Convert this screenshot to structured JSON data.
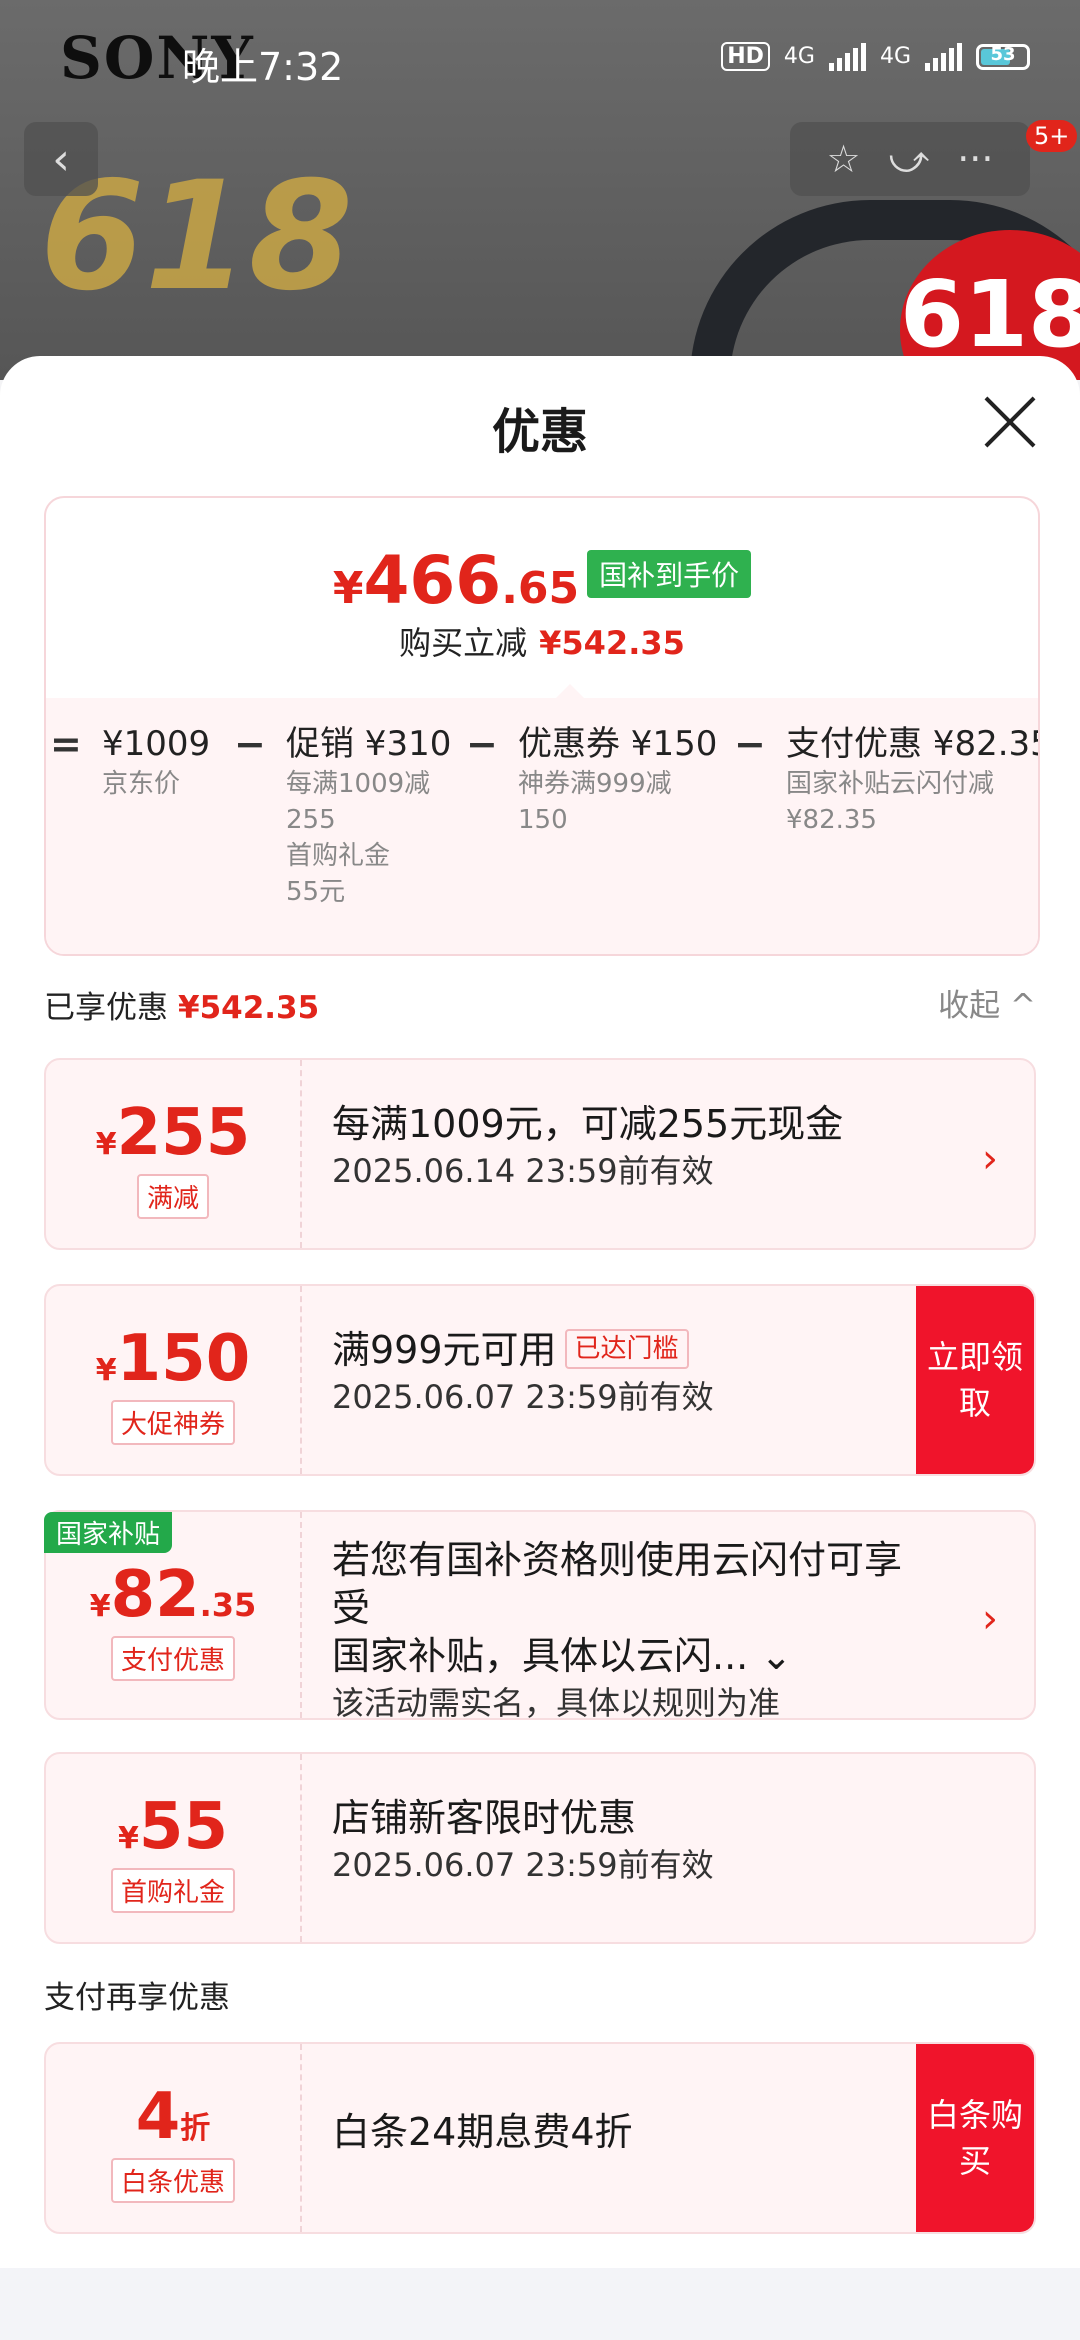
{
  "status_bar": {
    "time": "晚上7:32",
    "hd_label": "HD",
    "network_1": "4G",
    "network_2": "4G",
    "battery": "53"
  },
  "background": {
    "brand_logo": "SONY",
    "promo_badge": "618",
    "promo_deco": "618"
  },
  "top_actions": {
    "back_icon": "‹",
    "star_icon": "☆",
    "share_icon": "⤻",
    "more_icon": "···",
    "message_badge": "5+"
  },
  "sheet": {
    "title": "优惠",
    "summary": {
      "price_yen": "¥",
      "price_int": "466",
      "price_dec": ".65",
      "price_tag": "国补到手价",
      "reduce_label": "购买立减",
      "reduce_amount": "¥542.35",
      "calc": [
        {
          "op": "=",
          "head": "¥1009",
          "lines": [
            "京东价"
          ]
        },
        {
          "op": "−",
          "head": "促销 ¥310",
          "lines": [
            "每满1009减",
            "255",
            "首购礼金",
            "55元"
          ]
        },
        {
          "op": "−",
          "head": "优惠券 ¥150",
          "lines": [
            "神券满999减",
            "150"
          ]
        },
        {
          "op": "−",
          "head": "支付优惠 ¥82.35",
          "lines": [
            "国家补贴云闪付减",
            "¥82.35"
          ]
        }
      ]
    },
    "enjoyed_label": "已享优惠",
    "enjoyed_amount": "¥542.35",
    "collapse_label": "收起 ^",
    "coupons": [
      {
        "yen": "¥",
        "amount": "255",
        "dec": "",
        "label": "满减",
        "title": "每满1009元，可减255元现金",
        "subtitle": "2025.06.14 23:59前有效",
        "arrow": "›"
      },
      {
        "yen": "¥",
        "amount": "150",
        "dec": "",
        "label": "大促神券",
        "title": "满999元可用",
        "state": "已达门槛",
        "subtitle": "2025.06.07 23:59前有效",
        "cta": "立即领取"
      },
      {
        "gov_tag": "国家补贴",
        "yen": "¥",
        "amount": "82",
        "dec": ".35",
        "label": "支付优惠",
        "title": "若您有国补资格则使用云闪付可享受",
        "title2": "国家补贴，具体以云闪... ⌄",
        "subtitle": "该活动需实名，具体以规则为准",
        "arrow": "›"
      },
      {
        "yen": "¥",
        "amount": "55",
        "dec": "",
        "label": "首购礼金",
        "title": "店铺新客限时优惠",
        "subtitle": "2025.06.07 23:59前有效"
      }
    ],
    "pay_label": "支付再享优惠",
    "pay_coupon": {
      "amount": "4",
      "unit": "折",
      "label": "白条优惠",
      "title": "白条24期息费4折",
      "cta": "白条购买"
    }
  }
}
